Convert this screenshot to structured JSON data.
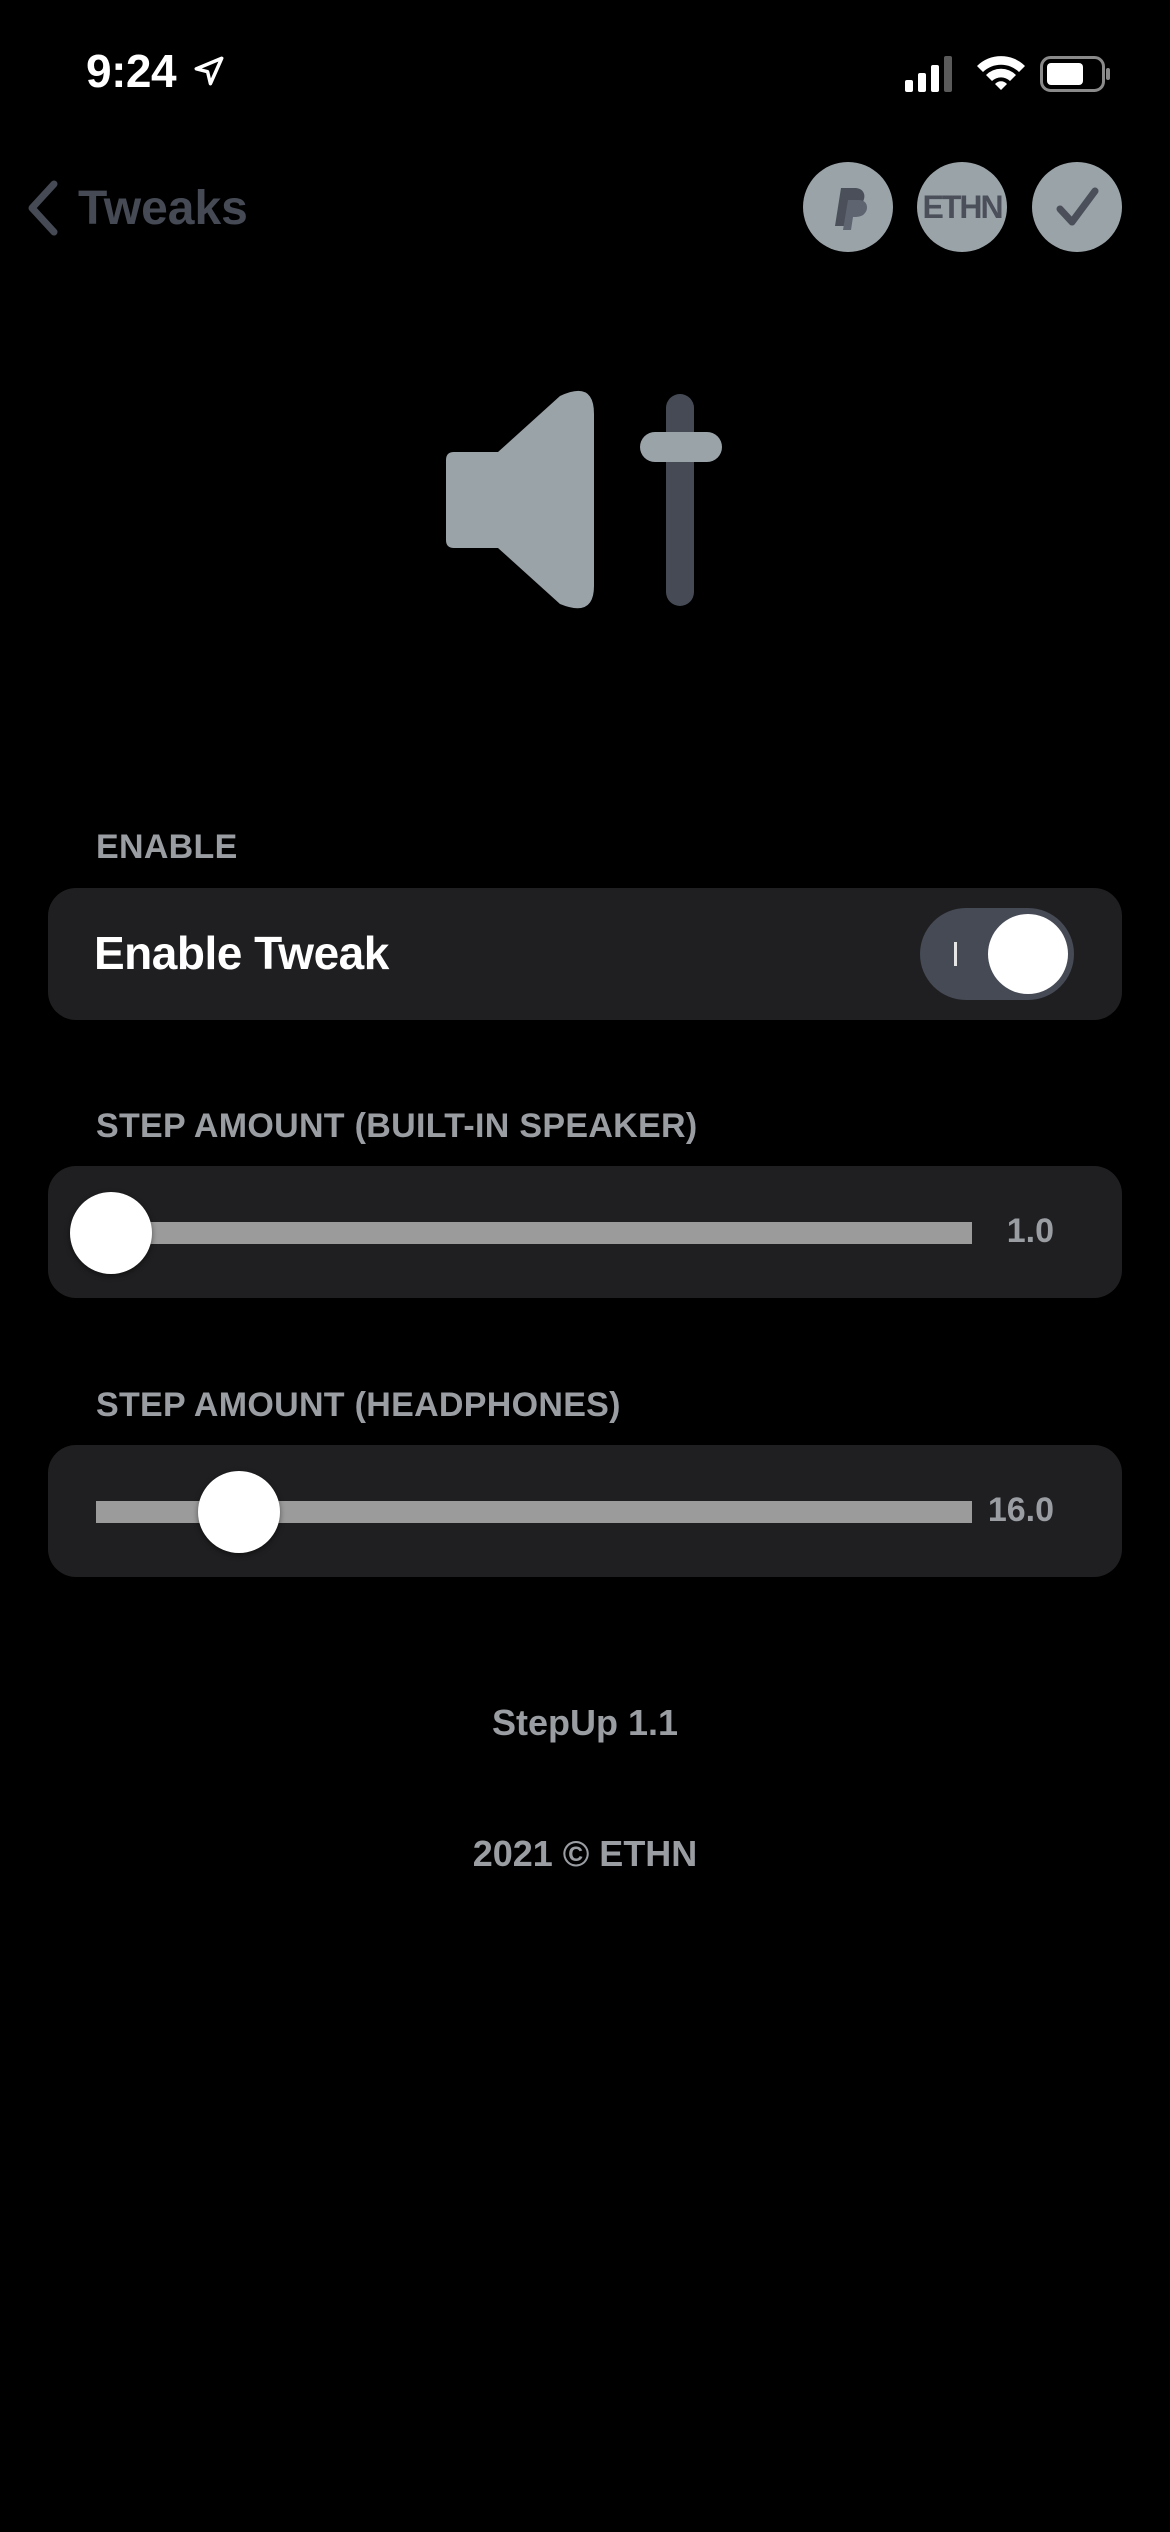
{
  "status_bar": {
    "time": "9:24"
  },
  "nav": {
    "back_label": "Tweaks",
    "buttons": [
      {
        "icon": "paypal-icon"
      },
      {
        "label": "ETHN"
      },
      {
        "icon": "checkmark-icon"
      }
    ]
  },
  "hero": {
    "icon": "speaker-volume-slider-icon"
  },
  "sections": {
    "enable": {
      "header": "ENABLE",
      "row_label": "Enable Tweak",
      "toggle_on": true
    },
    "speaker": {
      "header": "STEP AMOUNT (BUILT-IN SPEAKER)",
      "value": "1.0"
    },
    "headphones": {
      "header": "STEP AMOUNT (HEADPHONES)",
      "value": "16.0"
    }
  },
  "footer": {
    "version": "StepUp 1.1",
    "copyright": "2021 © ETHN"
  },
  "colors": {
    "background": "#000000",
    "card": "#1f1f21",
    "accent_gray": "#9aa3a8",
    "toggle_track": "#454a55",
    "secondary_text": "#9a9ea3"
  }
}
